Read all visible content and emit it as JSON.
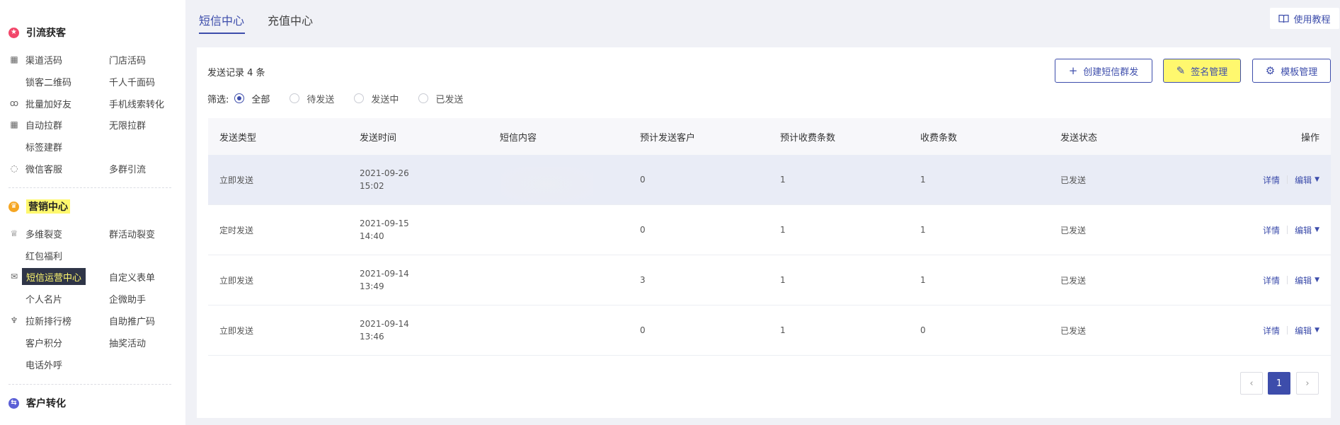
{
  "sidebar": {
    "sections": [
      {
        "title": "引流获客",
        "color": "#f2476a",
        "icon": "badge-icon"
      },
      {
        "title": "营销中心",
        "color": "#f5a623",
        "icon": "trophy-icon"
      },
      {
        "title": "客户转化",
        "color": "#5b5fd6",
        "icon": "swap-icon"
      }
    ],
    "items": [
      "渠道活码",
      "门店活码",
      "锁客二维码",
      "千人千面码",
      "批量加好友",
      "手机线索转化",
      "自动拉群",
      "无限拉群",
      "标签建群",
      "微信客服",
      "多群引流",
      "多维裂变",
      "群活动裂变",
      "红包福利",
      "短信运营中心",
      "自定义表单",
      "个人名片",
      "企微助手",
      "拉新排行榜",
      "自助推广码",
      "客户积分",
      "抽奖活动",
      "电话外呼"
    ]
  },
  "tabs": [
    {
      "label": "短信中心",
      "active": true
    },
    {
      "label": "充值中心",
      "active": false
    }
  ],
  "help": {
    "label": "使用教程"
  },
  "main": {
    "record_prefix": "发送记录",
    "record_count": "4 条",
    "filter": {
      "label": "筛选:",
      "options": [
        "全部",
        "待发送",
        "发送中",
        "已发送"
      ],
      "selected": "全部"
    },
    "buttons": {
      "create": "创建短信群发",
      "signature": "签名管理",
      "template": "模板管理"
    }
  },
  "table": {
    "headers": [
      "发送类型",
      "发送时间",
      "短信内容",
      "预计发送客户",
      "预计收费条数",
      "收费条数",
      "发送状态",
      "操作"
    ],
    "rows": [
      {
        "type": "立即发送",
        "date": "2021-09-26",
        "time": "15:02",
        "content": "",
        "est_customers": "0",
        "est_charge": "1",
        "charge": "1",
        "status": "已发送"
      },
      {
        "type": "定时发送",
        "date": "2021-09-15",
        "time": "14:40",
        "content": "",
        "est_customers": "0",
        "est_charge": "1",
        "charge": "1",
        "status": "已发送"
      },
      {
        "type": "立即发送",
        "date": "2021-09-14",
        "time": "13:49",
        "content": "",
        "est_customers": "3",
        "est_charge": "1",
        "charge": "1",
        "status": "已发送"
      },
      {
        "type": "立即发送",
        "date": "2021-09-14",
        "time": "13:46",
        "content": "",
        "est_customers": "0",
        "est_charge": "1",
        "charge": "0",
        "status": "已发送"
      }
    ],
    "actions": {
      "detail": "详情",
      "edit": "编辑"
    }
  },
  "pagination": {
    "current": "1",
    "prev": "‹",
    "next": "›"
  },
  "colors": {
    "accent": "#3d4dab",
    "highlight": "#fff86e",
    "sidebar_active_bg": "#2f3547"
  }
}
